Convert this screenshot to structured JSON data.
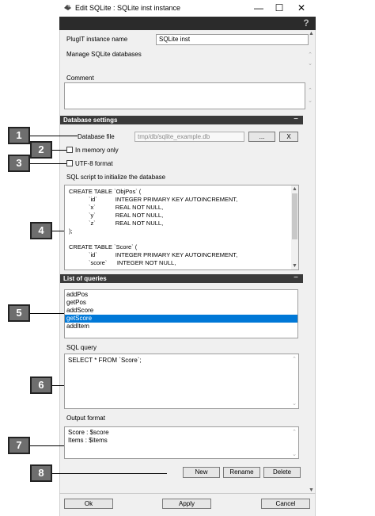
{
  "window": {
    "title": "Edit SQLite : SQLite inst instance",
    "controls": {
      "minimize": "—",
      "maximize": "☐",
      "close": "✕"
    },
    "help": "?"
  },
  "instance": {
    "name_label": "PlugIT instance name",
    "name_value": "SQLite inst",
    "description": "Manage SQLite databases",
    "comment_label": "Comment",
    "comment_value": ""
  },
  "database_settings": {
    "header": "Database settings",
    "minimize": "−",
    "file_label": "Database file",
    "file_value": "tmp/db/sqlite_example.db",
    "browse_label": "...",
    "clear_label": "X",
    "in_memory_label": "In memory only",
    "in_memory_checked": false,
    "utf8_label": "UTF-8 format",
    "utf8_checked": false,
    "script_label": "SQL script to initialize the database",
    "script_lines": [
      "CREATE TABLE `ObjPos` (",
      "            `id`           INTEGER PRIMARY KEY AUTOINCREMENT,",
      "            `x`            REAL NOT NULL,",
      "            `y`            REAL NOT NULL,",
      "            `z`            REAL NOT NULL,",
      ");",
      "",
      "CREATE TABLE `Score` (",
      "            `id`           INTEGER PRIMARY KEY AUTOINCREMENT,",
      "            `score`      INTEGER NOT NULL,"
    ]
  },
  "queries": {
    "header": "List of queries",
    "minimize": "−",
    "items": [
      "addPos",
      "getPos",
      "addScore",
      "getScore",
      "addItem"
    ],
    "selected": "getScore",
    "sql_label": "SQL query",
    "sql_value": "SELECT * FROM `Score`;",
    "output_label": "Output format",
    "output_lines": [
      "Score : $score",
      "Items : $items"
    ],
    "new_label": "New",
    "rename_label": "Rename",
    "delete_label": "Delete"
  },
  "footer": {
    "ok_label": "Ok",
    "apply_label": "Apply",
    "cancel_label": "Cancel"
  },
  "callouts": [
    "1",
    "2",
    "3",
    "4",
    "5",
    "6",
    "7",
    "8"
  ],
  "colors": {
    "section_bar": "#3a3a3a",
    "selection": "#0078d7",
    "callout": "#6e6e6e"
  }
}
